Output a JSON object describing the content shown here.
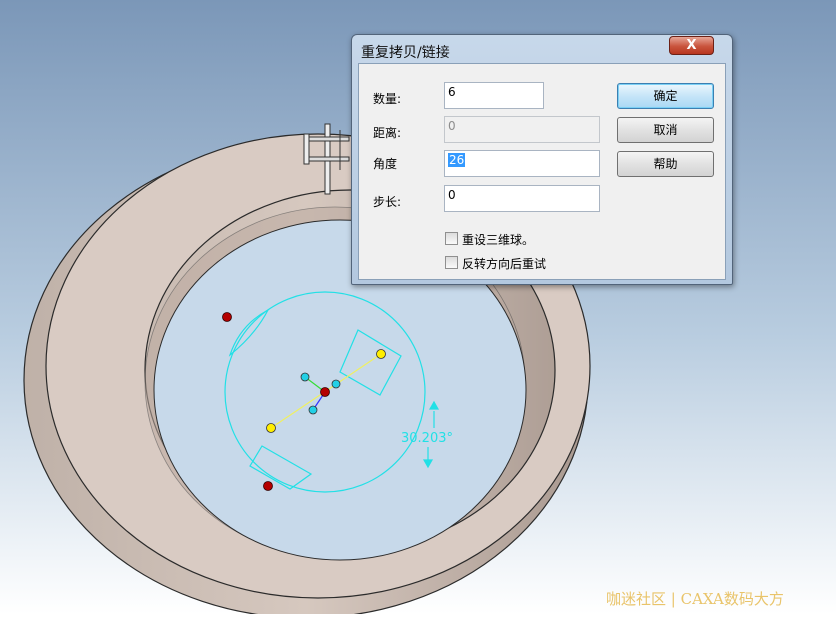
{
  "dialog": {
    "title": "重复拷贝/链接",
    "close_glyph": "X",
    "fields": {
      "count": {
        "label": "数量:",
        "value": "6"
      },
      "distance": {
        "label": "距离:",
        "value": "0"
      },
      "angle": {
        "label": "角度",
        "value": "26"
      },
      "step": {
        "label": "步长:",
        "value": "0"
      }
    },
    "buttons": {
      "ok": "确定",
      "cancel": "取消",
      "help": "帮助"
    },
    "checkboxes": {
      "reset_ball": {
        "label": "重设三维球。",
        "checked": false
      },
      "reverse_retry": {
        "label": "反转方向后重试",
        "checked": false
      }
    }
  },
  "viewport": {
    "angle_annotation": "30.203°",
    "watermark": "咖迷社区 | CAXA数码大方"
  },
  "colors": {
    "background_top": "#7b97b8",
    "background_bottom": "#ffffff",
    "ring": "#d9cbc3",
    "gizmo": "#22e0e6",
    "handle_red": "#b40000",
    "handle_yellow": "#ffee00"
  }
}
